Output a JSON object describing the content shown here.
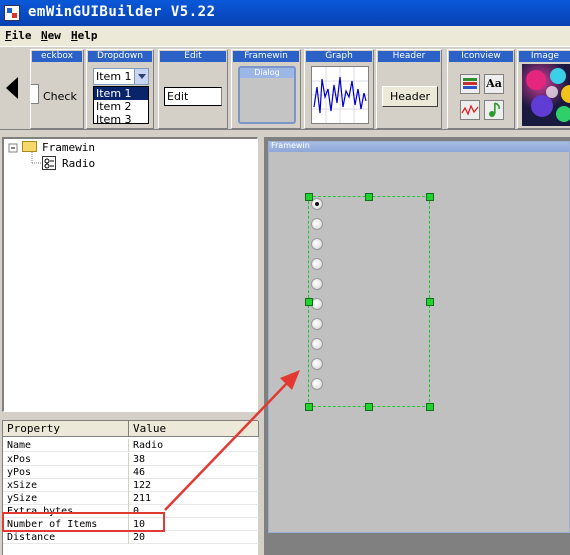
{
  "window": {
    "title": "emWinGUIBuilder V5.22"
  },
  "menu": [
    {
      "mnemonic": "F",
      "rest": "ile"
    },
    {
      "mnemonic": "N",
      "rest": "ew"
    },
    {
      "mnemonic": "H",
      "rest": "elp"
    }
  ],
  "toolbar": {
    "checkbox": {
      "head": "eckbox",
      "label": "Check"
    },
    "dropdown": {
      "head": "Dropdown",
      "value": "Item 1",
      "items": [
        "Item 1",
        "Item 2",
        "Item 3"
      ]
    },
    "edit": {
      "head": "Edit",
      "value": "Edit"
    },
    "framewin": {
      "head": "Framewin",
      "caption": "Dialog"
    },
    "graph": {
      "head": "Graph"
    },
    "header": {
      "head": "Header",
      "label": "Header"
    },
    "iconview": {
      "head": "Iconview",
      "glyph_text": "Aa",
      "icons": [
        "books-icon",
        "text-icon",
        "chart-line-icon",
        "music-note-icon"
      ]
    },
    "image": {
      "head": "Image"
    }
  },
  "tree": {
    "root": "Framewin",
    "child": "Radio"
  },
  "properties": {
    "col_property": "Property",
    "col_value": "Value",
    "rows": [
      {
        "name": "Name",
        "value": "Radio"
      },
      {
        "name": "xPos",
        "value": "38"
      },
      {
        "name": "yPos",
        "value": "46"
      },
      {
        "name": "xSize",
        "value": "122"
      },
      {
        "name": "ySize",
        "value": "211"
      },
      {
        "name": "Extra bytes",
        "value": "0"
      },
      {
        "name": "Number of Items",
        "value": "10"
      },
      {
        "name": "Distance",
        "value": "20"
      }
    ]
  },
  "canvas": {
    "framewin_caption": "Framewin",
    "radio_count": 10,
    "checked_index": 0
  },
  "colors": {
    "accent": "#2c62c8",
    "selection": "#22c531",
    "annotation": "#e23a33"
  }
}
